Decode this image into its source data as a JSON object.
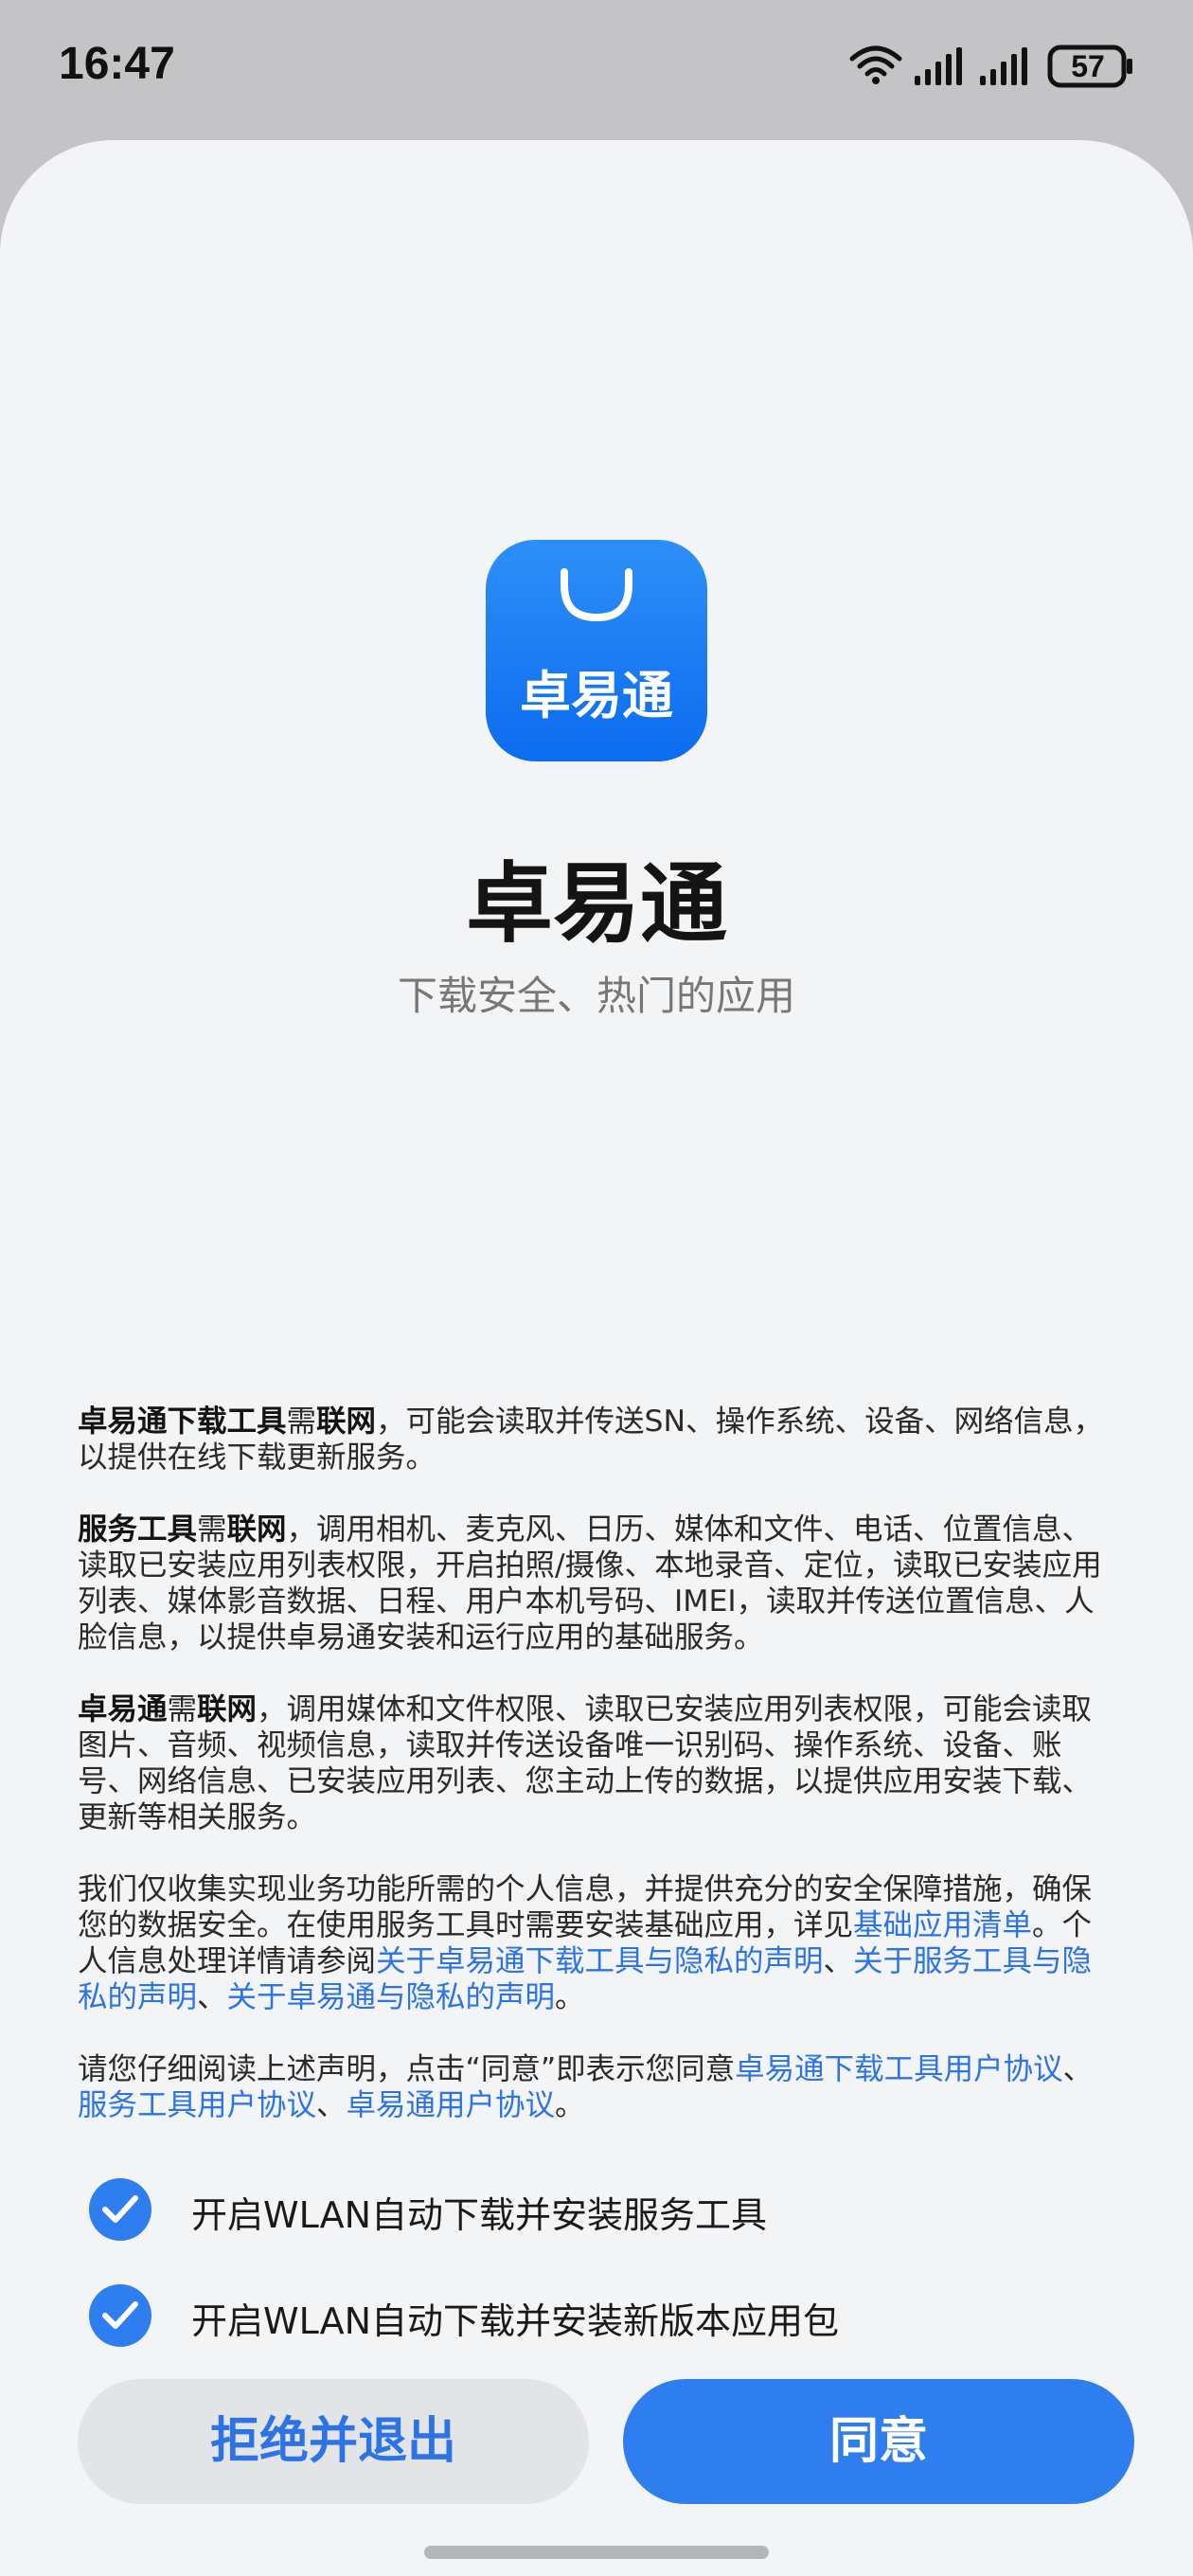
{
  "status_bar": {
    "time": "16:47",
    "battery": "57",
    "icons": [
      "wifi-icon",
      "signal-icon",
      "signal-icon",
      "battery-icon"
    ]
  },
  "app": {
    "icon_label": "卓易通",
    "title": "卓易通",
    "subtitle": "下载安全、热门的应用",
    "brand_color": "#1479f2"
  },
  "terms": {
    "p1": {
      "bold1": "卓易通下载工具",
      "text1": "需",
      "bold2": "联网",
      "text2": "，可能会读取并传送SN、操作系统、设备、网络信息，以提供在线下载更新服务。"
    },
    "p2": {
      "bold1": "服务工具",
      "text1": "需",
      "bold2": "联网",
      "text2": "，调用相机、麦克风、日历、媒体和文件、电话、位置信息、读取已安装应用列表权限，开启拍照/摄像、本地录音、定位，读取已安装应用列表、媒体影音数据、日程、用户本机号码、IMEI，读取并传送位置信息、人脸信息，以提供卓易通安装和运行应用的基础服务。"
    },
    "p3": {
      "bold1": "卓易通",
      "text1": "需",
      "bold2": "联网",
      "text2": "，调用媒体和文件权限、读取已安装应用列表权限，可能会读取图片、音频、视频信息，读取并传送设备唯一识别码、操作系统、设备、账号、网络信息、已安装应用列表、您主动上传的数据，以提供应用安装下载、更新等相关服务。"
    },
    "p4": {
      "text1": "我们仅收集实现业务功能所需的个人信息，并提供充分的安全保障措施，确保您的数据安全。在使用服务工具时需要安装基础应用，详见",
      "link1": "基础应用清单",
      "text2": "。个人信息处理详情请参阅",
      "link2": "关于卓易通下载工具与隐私的声明",
      "sep1": "、",
      "link3": "关于服务工具与隐私的声明",
      "sep2": "、",
      "link4": "关于卓易通与隐私的声明",
      "text3": "。"
    },
    "p5": {
      "text1": "请您仔细阅读上述声明，点击“同意”即表示您同意",
      "link1": "卓易通下载工具用户协议",
      "sep1": "、",
      "link2": "服务工具用户协议",
      "sep2": "、",
      "link3": "卓易通用户协议",
      "text2": "。"
    },
    "link_color": "#2b73e6"
  },
  "options": [
    {
      "label": "开启WLAN自动下载并安装服务工具",
      "checked": true
    },
    {
      "label": "开启WLAN自动下载并安装新版本应用包",
      "checked": true
    }
  ],
  "buttons": {
    "reject": "拒绝并退出",
    "agree": "同意"
  }
}
